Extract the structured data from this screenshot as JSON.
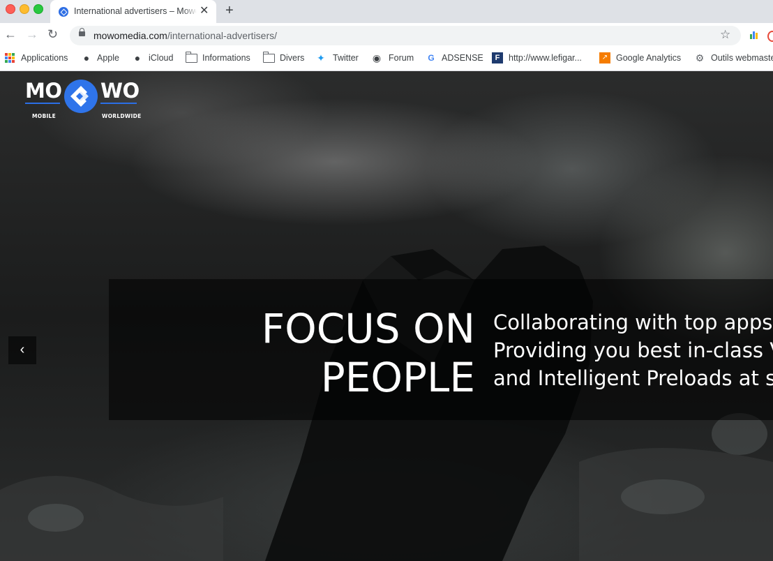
{
  "browser": {
    "tab": {
      "title": "International advertisers – Mowomedia"
    },
    "url": {
      "domain": "mowomedia.com",
      "path": "/international-advertisers/"
    },
    "bookmarks": [
      {
        "label": "Applications",
        "icon": "apps-grid-icon"
      },
      {
        "label": "Apple",
        "icon": "apple-icon"
      },
      {
        "label": "iCloud",
        "icon": "apple-icon"
      },
      {
        "label": "Informations",
        "icon": "folder-icon"
      },
      {
        "label": "Divers",
        "icon": "folder-icon"
      },
      {
        "label": "Twitter",
        "icon": "twitter-icon"
      },
      {
        "label": "Forum",
        "icon": "globe-icon"
      },
      {
        "label": "ADSENSE",
        "icon": "google-icon"
      },
      {
        "label": "http://www.lefigar...",
        "icon": "lefigaro-icon"
      },
      {
        "label": "Google Analytics",
        "icon": "analytics-icon"
      },
      {
        "label": "Outils webmaste",
        "icon": "webmaster-icon"
      }
    ]
  },
  "site": {
    "logo": {
      "left": "MO",
      "right": "WO",
      "left_sub": "MOBILE",
      "right_sub": "WORLDWIDE"
    },
    "hero": {
      "headline_line1": "FOCUS ON",
      "headline_line2": "PEOPLE",
      "tagline_line1": "Collaborating with top apps",
      "tagline_line2": "Providing you best in-class Video",
      "tagline_line3": "and Intelligent Preloads at scale"
    }
  },
  "colors": {
    "brand_blue": "#2f74ea",
    "tab_strip": "#dee1e6"
  }
}
